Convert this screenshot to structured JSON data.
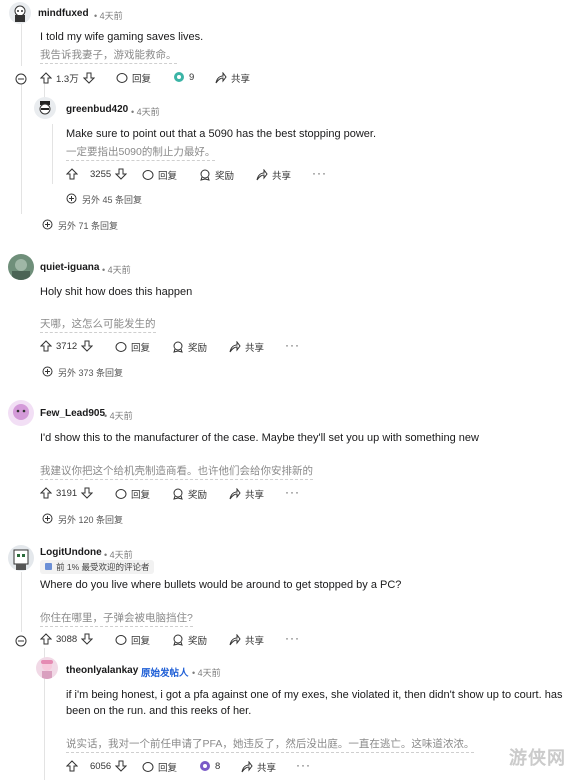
{
  "c1": {
    "user": "mindfuxed",
    "time": "• 4天前",
    "text": "I told my wife gaming saves lives.",
    "zh": "我告诉我妻子，游戏能救命。",
    "votes": "1.3万",
    "reply": "回复",
    "award_count": "9",
    "share": "共享"
  },
  "c2": {
    "user": "greenbud420",
    "time": "• 4天前",
    "text": "Make sure to point out that a 5090 has the best stopping power.",
    "zh": "一定要指出5090的制止力最好。",
    "votes": "3255",
    "reply": "回复",
    "award": "奖励",
    "share": "共享",
    "dots": "···",
    "more": "另外 45 条回复"
  },
  "c1_more": "另外 71 条回复",
  "c3": {
    "user": "quiet-iguana",
    "time": "• 4天前",
    "text": "Holy shit how does this happen",
    "zh": "天哪，这怎么可能发生的",
    "votes": "3712",
    "reply": "回复",
    "award": "奖励",
    "share": "共享",
    "dots": "···",
    "more": "另外 373 条回复"
  },
  "c4": {
    "user": "Few_Lead905",
    "time": "• 4天前",
    "text": "I'd show this to the manufacturer of the case. Maybe they'll set you up with something new",
    "zh": "我建议你把这个给机壳制造商看。也许他们会给你安排新的",
    "votes": "3191",
    "reply": "回复",
    "award": "奖励",
    "share": "共享",
    "dots": "···",
    "more": "另外 120 条回复"
  },
  "c5": {
    "user": "LogitUndone",
    "time": "• 4天前",
    "flair": "前 1% 最受欢迎的评论者",
    "text": "Where do you live where bullets would be around to get stopped by a PC?",
    "zh": "你住在哪里，子弹会被电脑挡住?",
    "votes": "3088",
    "reply": "回复",
    "award": "奖励",
    "share": "共享",
    "dots": "···"
  },
  "c6": {
    "user": "theonlyalankay",
    "op": "原始发帖人",
    "time": "• 4天前",
    "text1": "if i'm being honest, i got a pfa against one of my exes, she violated it, then didn't show up to court. has",
    "text2": "been on the run. and this reeks of her.",
    "zh": "说实话，我对一个前任申请了PFA，她违反了，然后没出庭。一直在逃亡。这味道浓浓。",
    "votes": "6056",
    "reply": "回复",
    "award_count": "8",
    "share": "共享",
    "dots": "···"
  },
  "watermark": "游侠网"
}
